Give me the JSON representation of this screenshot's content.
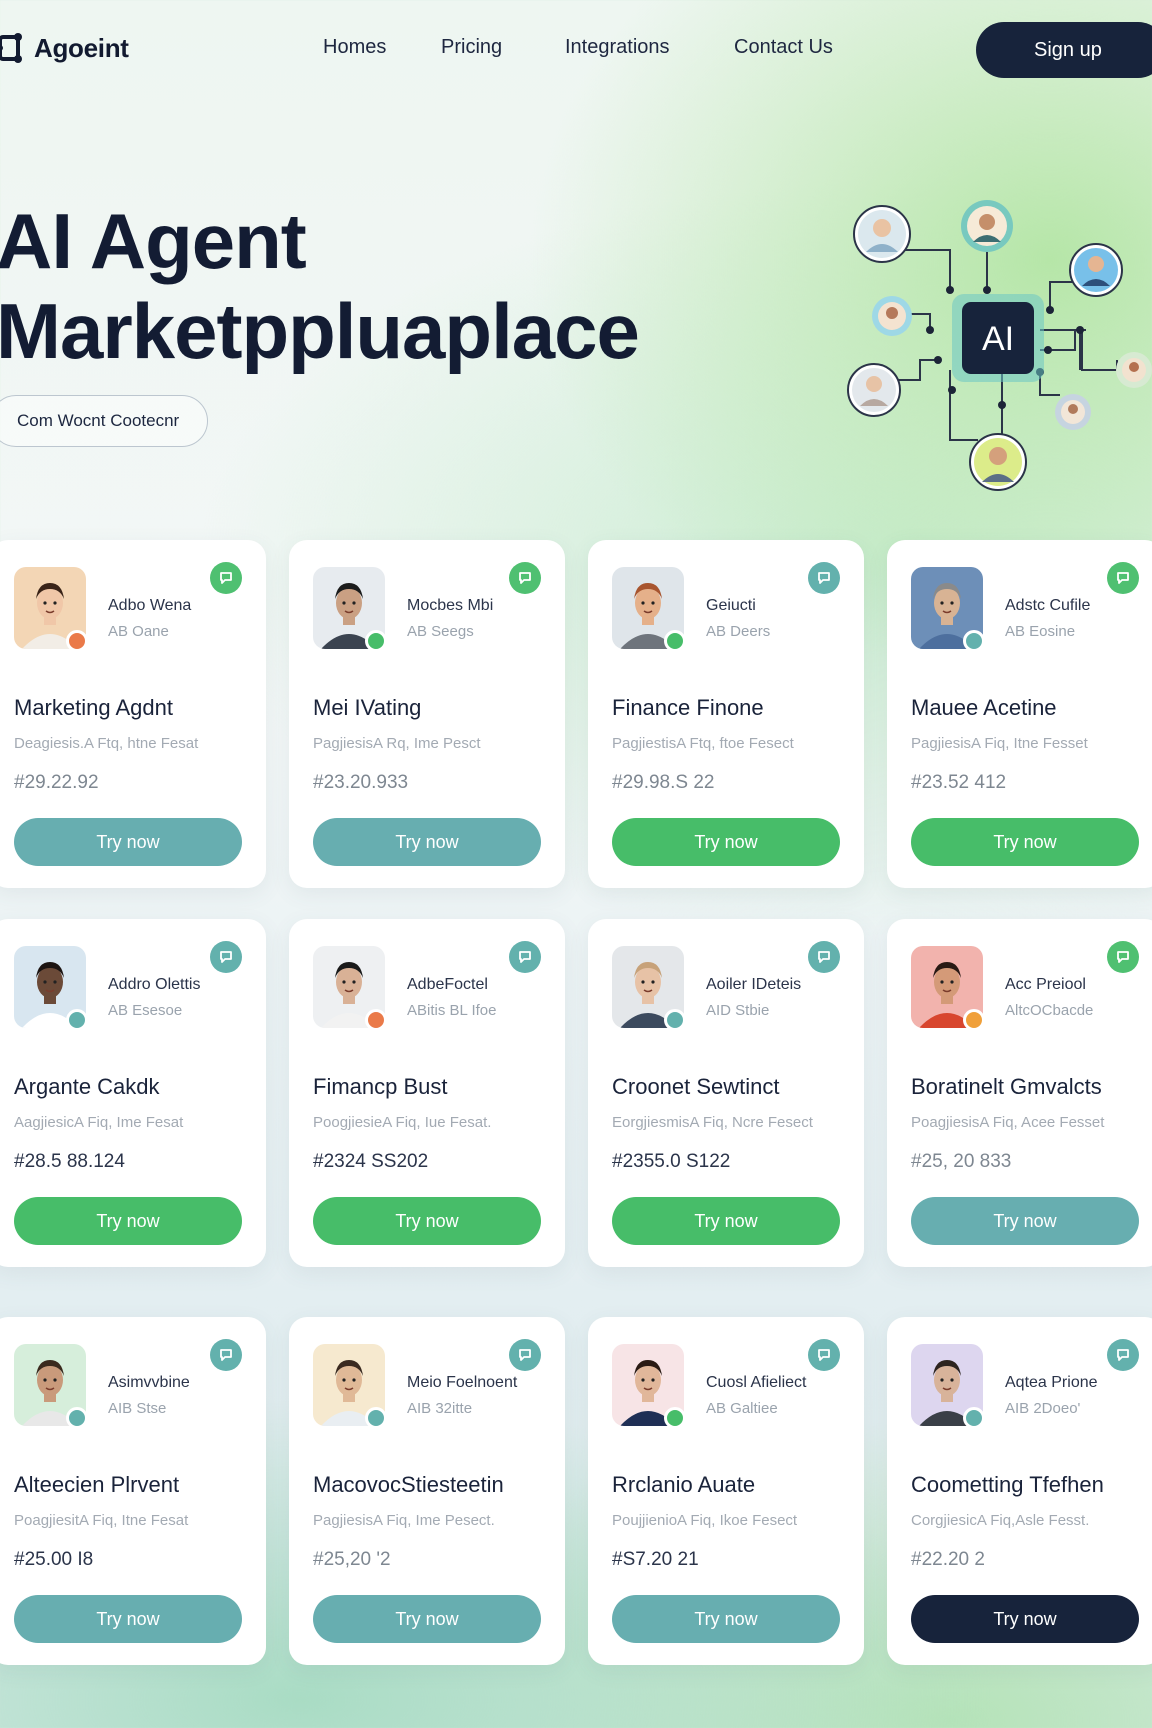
{
  "brand": {
    "name": "Agoeint"
  },
  "nav": {
    "links": [
      "Homes",
      "Pricing",
      "Integrations",
      "Contact Us"
    ],
    "signup": "Sign up"
  },
  "hero": {
    "title_line1": "AI Agent",
    "title_line2": "Marketppluaplace",
    "pill": "Com Wocnt Cootecnr",
    "chip_label": "AI"
  },
  "colors": {
    "navy": "#17233b",
    "teal": "#67aeb0",
    "green": "#47bd69"
  },
  "cards": [
    {
      "meta_name": "Adbo Wena",
      "meta_sub": "AB Oane",
      "title": "Marketing Agdnt",
      "desc": "Deagiesis.A Ftq, htne Fesat",
      "price": "#29.22.92",
      "button": "Try now",
      "button_style": "teal",
      "chat_icon": "chat-icon",
      "avatar_bg": "#f3d6b5"
    },
    {
      "meta_name": "Mocbes Mbi",
      "meta_sub": "AB Seegs",
      "title": "Mei IVating",
      "desc": "PagjiesisA Rq, Ime Pesct",
      "price": "#23.20.933",
      "button": "Try now",
      "button_style": "teal",
      "chat_icon": "chat-icon",
      "avatar_bg": "#e7ebef"
    },
    {
      "meta_name": "Geiucti",
      "meta_sub": "AB Deers",
      "title": "Finance Finone",
      "desc": "PagjiestisA Ftq, ftoe Fesect",
      "price": "#29.98.S 22",
      "button": "Try now",
      "button_style": "green",
      "chat_icon": "chat-icon",
      "avatar_bg": "#dfe5ea"
    },
    {
      "meta_name": "Adstc Cufile",
      "meta_sub": "AB Eosine",
      "title": "Mauee Acetine",
      "desc": "PagjiesisA Fiq, Itne Fesset",
      "price": "#23.52 412",
      "button": "Try now",
      "button_style": "green",
      "chat_icon": "chat-icon",
      "avatar_bg": "#6d8fb8"
    },
    {
      "meta_name": "Addro Olettis",
      "meta_sub": "AB Esesoe",
      "title": "Argante Cakdk",
      "desc": "AagjiesicA Fiq, Ime Fesat",
      "price": "#28.5 88.124",
      "button": "Try now",
      "button_style": "green",
      "chat_icon": "chat-icon",
      "avatar_bg": "#d8e6f0"
    },
    {
      "meta_name": "AdbeFoctel",
      "meta_sub": "ABitis BL Ifoe",
      "title": "Fimancp Bust",
      "desc": "PoogjiesieA Fiq, Iue Fesat.",
      "price": "#2324 SS202",
      "button": "Try now",
      "button_style": "green",
      "chat_icon": "chat-icon",
      "avatar_bg": "#eef0f2"
    },
    {
      "meta_name": "Aoiler IDeteis",
      "meta_sub": "AID Stbie",
      "title": "Croonet Sewtinct",
      "desc": "EorgjiesmisA Fiq, Ncre Fesect",
      "price": "#2355.0 S122",
      "button": "Try now",
      "button_style": "green",
      "chat_icon": "chat-icon",
      "avatar_bg": "#e4e7ea"
    },
    {
      "meta_name": "Acc Preiool",
      "meta_sub": "AltcOCbacde",
      "title": "Boratinelt Gmvalcts",
      "desc": "PoagjiesisA Fiq, Acee Fesset",
      "price": "#25, 20 833",
      "button": "Try now",
      "button_style": "teal",
      "chat_icon": "chat-icon",
      "avatar_bg": "#f2b3ad"
    },
    {
      "meta_name": "Asimvvbine",
      "meta_sub": "AIB Stse",
      "title": "Alteecien Plrvent",
      "desc": "PoagjiesitA Fiq, Itne Fesat",
      "price": "#25.00 I8",
      "button": "Try now",
      "button_style": "teal",
      "chat_icon": "chat-icon",
      "avatar_bg": "#d6eedb"
    },
    {
      "meta_name": "Meio Foelnoent",
      "meta_sub": "AIB 32itte",
      "title": "MacovocStiesteetin",
      "desc": "PagjiesisA Fiq, Ime Pesect.",
      "price": "#25,20 '2",
      "button": "Try now",
      "button_style": "teal",
      "chat_icon": "chat-icon",
      "avatar_bg": "#f6e9cf"
    },
    {
      "meta_name": "Cuosl Afieliect",
      "meta_sub": "AB Galtiee",
      "title": "Rrclanio Auate",
      "desc": "PoujjienioA Fiq, Ikoe Fesect",
      "price": "#S7.20 21",
      "button": "Try now",
      "button_style": "teal",
      "chat_icon": "chat-icon",
      "avatar_bg": "#f7e4e6"
    },
    {
      "meta_name": "Aqtea Prione",
      "meta_sub": "AIB 2Doeo'",
      "title": "Coometting Tfefhen",
      "desc": "CorgjiesicA Fiq,Asle Fesst.",
      "price": "#22.20 2",
      "button": "Try now",
      "button_style": "navy",
      "chat_icon": "chat-icon",
      "avatar_bg": "#ddd6ef"
    }
  ]
}
